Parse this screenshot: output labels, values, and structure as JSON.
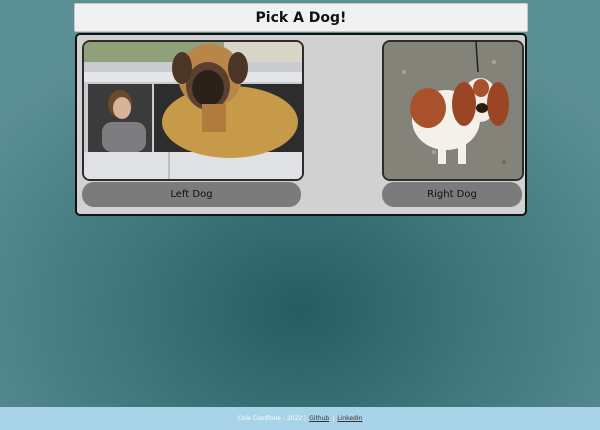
{
  "header": {
    "title": "Pick A Dog!"
  },
  "choices": {
    "left_label": "Left Dog",
    "right_label": "Right Dog"
  },
  "footer": {
    "credit": "Cole Cianflone - 2022 |",
    "github_label": "Github",
    "separator": "|",
    "linkedin_label": "LinkedIn"
  }
}
